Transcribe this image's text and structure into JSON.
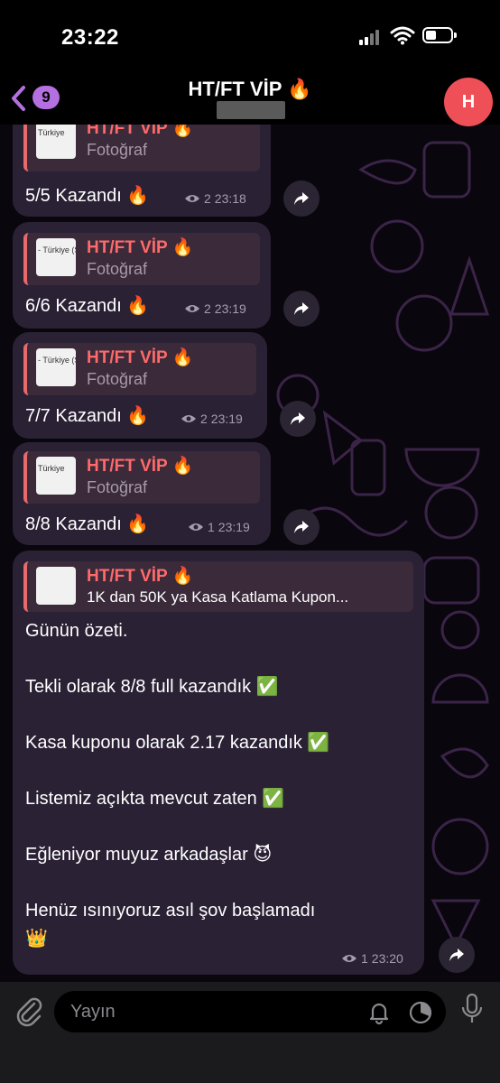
{
  "status_bar": {
    "time": "23:22"
  },
  "header": {
    "back_badge": "9",
    "title": "HT/FT VİP 🔥",
    "avatar_letter": "H"
  },
  "messages": [
    {
      "quote_title": "HT/FT VİP 🔥",
      "quote_sub": "Fotoğraf",
      "thumb_text": "Türkiye",
      "text": "5/5 Kazandı 🔥",
      "views": "2",
      "time": "23:18"
    },
    {
      "quote_title": "HT/FT VİP 🔥",
      "quote_sub": "Fotoğraf",
      "thumb_text": "- Türkiye (S",
      "text": "6/6 Kazandı 🔥",
      "views": "2",
      "time": "23:19"
    },
    {
      "quote_title": "HT/FT VİP 🔥",
      "quote_sub": "Fotoğraf",
      "thumb_text": "- Türkiye (S",
      "text": "7/7 Kazandı 🔥",
      "views": "2",
      "time": "23:19"
    },
    {
      "quote_title": "HT/FT VİP 🔥",
      "quote_sub": "Fotoğraf",
      "thumb_text": "Türkiye",
      "text": "8/8 Kazandı 🔥",
      "views": "1",
      "time": "23:19"
    },
    {
      "quote_title": "HT/FT VİP 🔥",
      "quote_sub": "1K dan 50K ya Kasa Katlama Kupon...",
      "thumb_text": "",
      "text": "Günün özeti.\n\nTekli olarak 8/8 full kazandık ✅\n\nKasa kuponu olarak 2.17 kazandık ✅\n\nListemiz açıkta mevcut zaten ✅\n\nEğleniyor muyuz arkadaşlar 😈\n\nHenüz ısınıyoruz asıl şov başlamadı\n👑",
      "views": "1",
      "time": "23:20"
    }
  ],
  "composer": {
    "placeholder": "Yayın"
  },
  "colors": {
    "accent": "#b46fe0",
    "quote_title": "#ff6a6a",
    "bubble": "#2a2135",
    "avatar": "#ef4f57"
  },
  "icons": [
    "back-chevron-icon",
    "wifi-icon",
    "battery-icon",
    "eye-icon",
    "share-arrow-icon",
    "paperclip-icon",
    "bell-icon",
    "timer-icon",
    "microphone-icon"
  ]
}
